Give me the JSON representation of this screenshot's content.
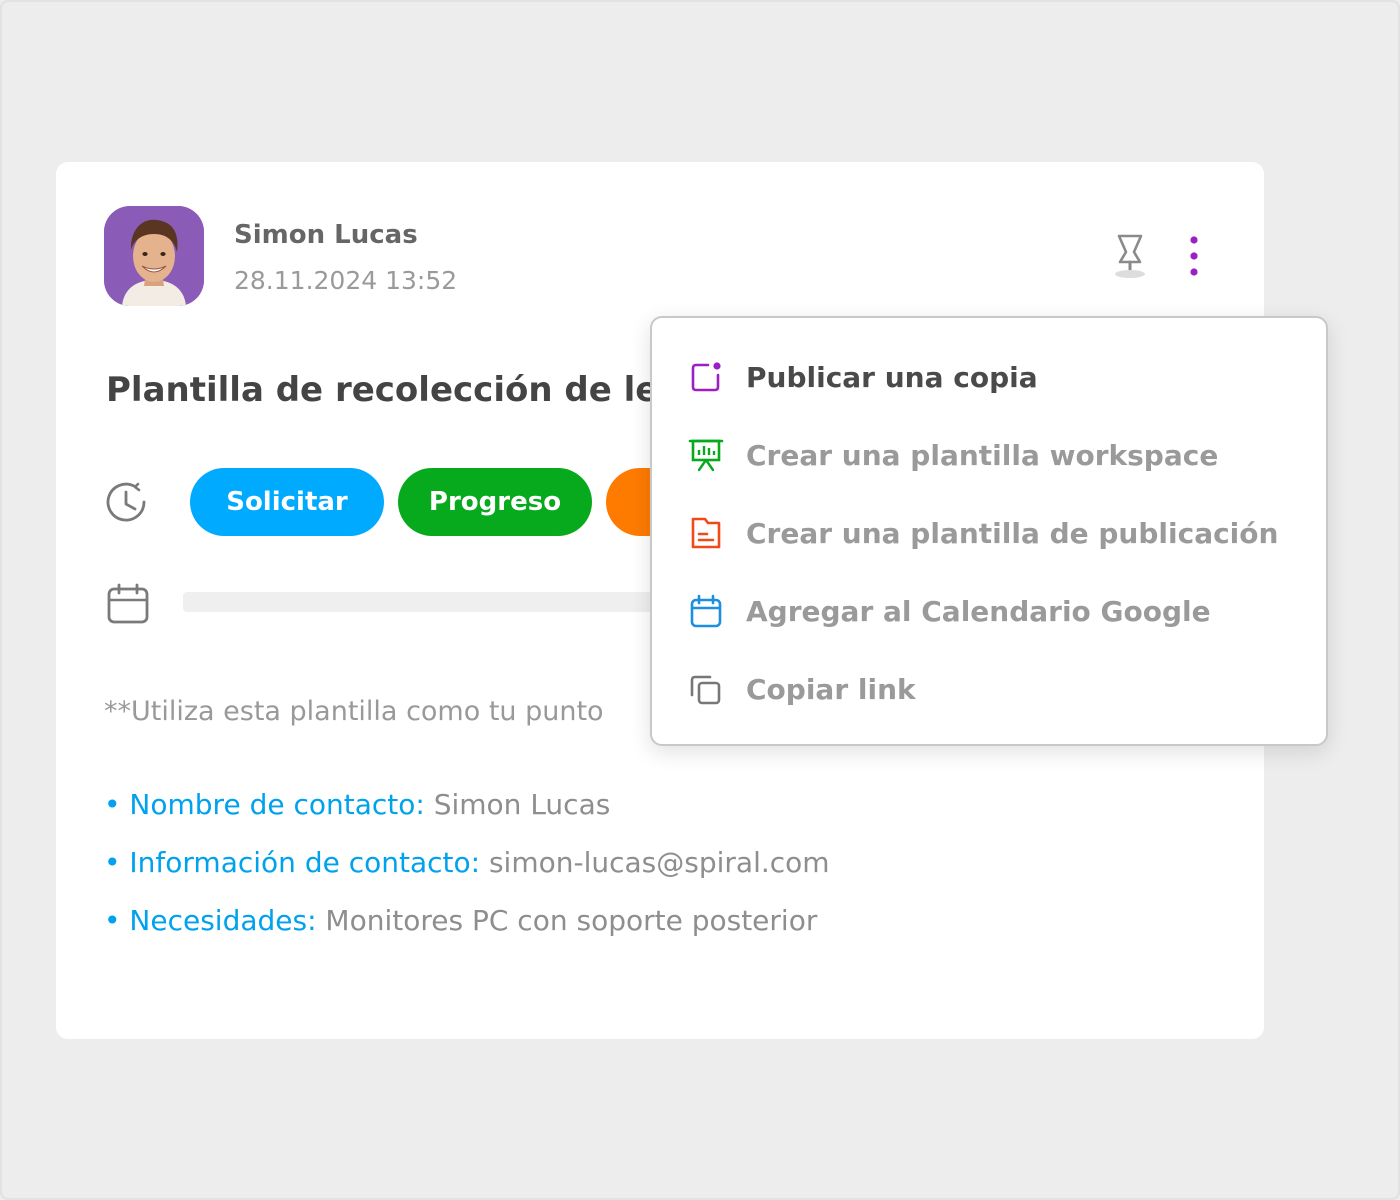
{
  "post": {
    "author": "Simon Lucas",
    "timestamp": "28.11.2024 13:52",
    "title": "Plantilla de recolección de lea",
    "description": "**Utiliza esta plantilla como tu punto"
  },
  "status_tags": [
    {
      "label": "Solicitar",
      "color": "#00aaff"
    },
    {
      "label": "Progreso",
      "color": "#07a91d"
    },
    {
      "label": "",
      "color": "#ff7b00"
    }
  ],
  "fields": [
    {
      "key": "• Nombre de contacto:",
      "value": " Simon Lucas"
    },
    {
      "key": "• Información de contacto:",
      "value": " simon-lucas@spiral.com"
    },
    {
      "key": "• Necesidades:",
      "value": " Monitores PC con soporte posterior"
    }
  ],
  "menu": {
    "items": [
      {
        "label": "Publicar una copia",
        "icon": "publish-copy-icon",
        "color": "#9b1fc4"
      },
      {
        "label": "Crear una plantilla workspace",
        "icon": "presentation-board-icon",
        "color": "#07a91d"
      },
      {
        "label": "Crear una plantilla de publicación",
        "icon": "document-icon",
        "color": "#f04a1a"
      },
      {
        "label": "Agregar al Calendario Google",
        "icon": "calendar-icon",
        "color": "#1d8fe0"
      },
      {
        "label": "Copiar link",
        "icon": "copy-icon",
        "color": "#777777"
      }
    ]
  },
  "icons": {
    "pin": "pin-icon",
    "more": "more-vertical-icon",
    "status": "clock-history-icon",
    "date": "calendar-icon"
  },
  "colors": {
    "accent": "#9b1fc4",
    "link_key": "#00a2ee"
  }
}
